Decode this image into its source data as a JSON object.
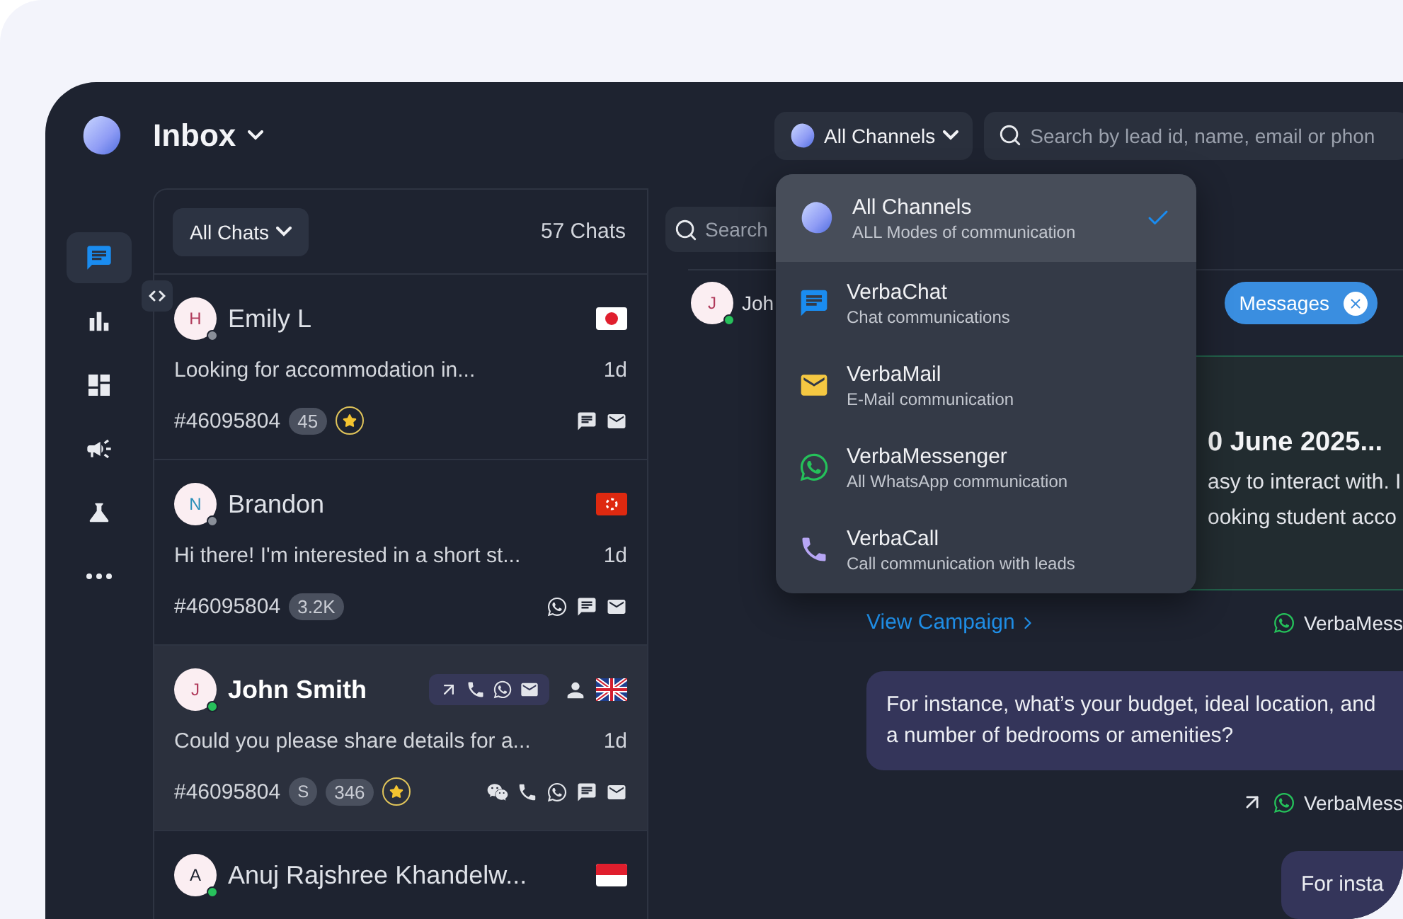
{
  "header": {
    "title": "Inbox",
    "channel_button": "All Channels",
    "search": {
      "placeholder": "Search by lead id, name, email or phon"
    }
  },
  "rail": [
    {
      "kind": "chat",
      "selected": true
    },
    {
      "kind": "reports",
      "selected": false
    },
    {
      "kind": "dashboard",
      "selected": false
    },
    {
      "kind": "campaign",
      "selected": false
    },
    {
      "kind": "lab",
      "selected": false
    },
    {
      "kind": "more",
      "selected": false
    }
  ],
  "chat_list": {
    "filter": "All Chats",
    "count": "57 Chats",
    "chats": [
      {
        "initial": "H",
        "color": "#b03a5b",
        "name": "Emily L",
        "online": false,
        "flag": {
          "kind": "jp"
        },
        "preview": "Looking for accommodation in...",
        "time": "1d",
        "lead_id": "#46095804",
        "tags": [
          {
            "kind": "count",
            "text": "45"
          },
          {
            "kind": "star"
          }
        ],
        "channels": [
          {
            "kind": "chat"
          },
          {
            "kind": "mail"
          }
        ],
        "selected": false
      },
      {
        "initial": "N",
        "color": "#2a8fb8",
        "name": "Brandon",
        "online": false,
        "flag": {
          "kind": "hk"
        },
        "preview": "Hi there! I'm interested in a short st...",
        "time": "1d",
        "lead_id": "#46095804",
        "tags": [
          {
            "kind": "count",
            "text": "3.2K"
          }
        ],
        "channels": [
          {
            "kind": "whatsapp"
          },
          {
            "kind": "chat"
          },
          {
            "kind": "mail"
          }
        ],
        "selected": false
      },
      {
        "initial": "J",
        "color": "#b03a5b",
        "name": "John Smith",
        "online": true,
        "flag": {
          "kind": "uk"
        },
        "preview": "Could you please share details for a...",
        "time": "1d",
        "lead_id": "#46095804",
        "tags": [
          {
            "kind": "letter",
            "text": "S"
          },
          {
            "kind": "count",
            "text": "346"
          },
          {
            "kind": "star"
          }
        ],
        "channels": [
          {
            "kind": "wechat"
          },
          {
            "kind": "call"
          },
          {
            "kind": "whatsapp"
          },
          {
            "kind": "chat"
          },
          {
            "kind": "mail"
          }
        ],
        "quick_actions": [
          {
            "kind": "outgoing"
          },
          {
            "kind": "call"
          },
          {
            "kind": "whatsapp"
          },
          {
            "kind": "mail"
          }
        ],
        "assigned": true,
        "selected": true
      },
      {
        "initial": "A",
        "color": "#1f2430",
        "name": "Anuj Rajshree Khandelw...",
        "online": true,
        "flag": {
          "kind": "id"
        },
        "selected": false
      }
    ]
  },
  "conversation": {
    "search": {
      "placeholder": "Search"
    },
    "lead": {
      "initial": "J",
      "name": "Joh",
      "online": true
    },
    "filter_pill": "Messages",
    "campaign": {
      "title": "0 June 2025...",
      "body_lines": [
        "asy to interact with. I",
        "ooking student acco"
      ],
      "link": "View Campaign",
      "channel": "VerbaMess"
    },
    "messages": [
      {
        "text": "For instance, what’s your budget, ideal location, and a number of bedrooms or amenities?",
        "outgoing": true,
        "channel": "VerbaMess"
      },
      {
        "text": "For insta"
      }
    ]
  },
  "channel_menu": {
    "open": true,
    "items": [
      {
        "kind": "all",
        "title": "All Channels",
        "subtitle": "ALL Modes of communication",
        "selected": true
      },
      {
        "kind": "chat",
        "title": "VerbaChat",
        "subtitle": "Chat communications",
        "selected": false
      },
      {
        "kind": "mail",
        "title": "VerbaMail",
        "subtitle": "E-Mail communication",
        "selected": false
      },
      {
        "kind": "whatsapp",
        "title": "VerbaMessenger",
        "subtitle": "All WhatsApp communication",
        "selected": false
      },
      {
        "kind": "call",
        "title": "VerbaCall",
        "subtitle": "Call communication with leads",
        "selected": false
      }
    ]
  }
}
